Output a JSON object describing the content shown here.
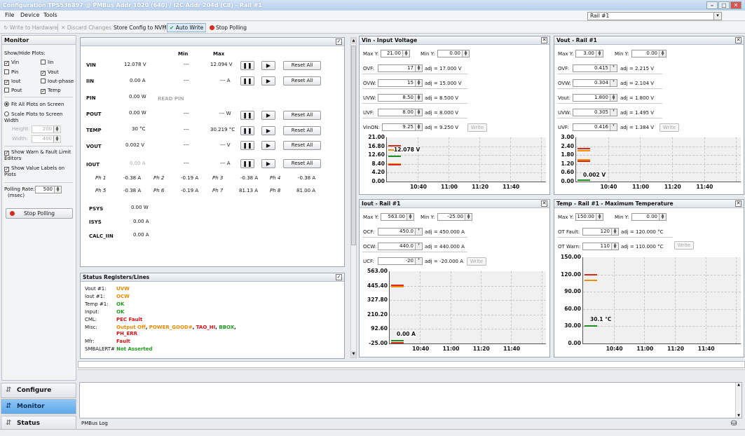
{
  "window": {
    "title": "Configuration TPS536897 @ PMBus Addr 1020 (640) / I2C Addr 204d (C8) - Rail #1"
  },
  "menu": [
    "File",
    "Device",
    "Tools"
  ],
  "rail_select": "Rail #1",
  "toolbar": {
    "write_hw": "Write to Hardware",
    "discard": "Discard Changes",
    "store": "Store Config to NVM",
    "auto_write": "Auto Write",
    "stop_polling": "Stop Polling"
  },
  "monitor": {
    "title": "Monitor",
    "show_hide": "Show/Hide Plots:",
    "plots": [
      {
        "label": "Vin",
        "checked": true
      },
      {
        "label": "Iin",
        "checked": false
      },
      {
        "label": "Pin",
        "checked": false
      },
      {
        "label": "Vout",
        "checked": true
      },
      {
        "label": "Iout",
        "checked": true
      },
      {
        "label": "Iout-phase",
        "checked": false
      },
      {
        "label": "Pout",
        "checked": false
      },
      {
        "label": "Temp",
        "checked": true
      }
    ],
    "fit_all": "Fit All Plots on Screen",
    "scale_plots": "Scale Plots to Screen Width",
    "height_label": "Height:",
    "height_value": "200",
    "width_label": "Width:",
    "width_value": "400",
    "show_warn": "Show Warn & Fault Limit Editors",
    "show_value_labels": "Show Value Labels on Plots",
    "polling_label": "Polling Rate:",
    "polling_unit": "(msec)",
    "polling_value": "500",
    "stop_polling": "Stop Polling"
  },
  "nav": {
    "configure": "Configure",
    "monitor": "Monitor",
    "status": "Status"
  },
  "readings": {
    "col_min": "Min",
    "col_max": "Max",
    "vin": {
      "label": "VIN",
      "value": "12.078 V",
      "min": "---",
      "max": "12.094 V"
    },
    "iin": {
      "label": "IIN",
      "value": "0.00 A",
      "min": "---",
      "max": "--- A"
    },
    "pin": {
      "label": "PIN",
      "value": "0.00 W",
      "note": "READ PIN"
    },
    "pout": {
      "label": "POUT",
      "value": "0.00 W",
      "min": "---",
      "max": "--- W"
    },
    "temp": {
      "label": "TEMP",
      "value": "30 °C",
      "min": "---",
      "max": "30.219 °C"
    },
    "vout": {
      "label": "VOUT",
      "value": "0.002 V",
      "min": "---",
      "max": "--- V"
    },
    "iout": {
      "label": "IOUT",
      "value": "0.00 A",
      "min": "---",
      "max": "--- A"
    },
    "reset_all": "Reset All",
    "phases": [
      {
        "name": "Ph 1",
        "value": "-0.38 A"
      },
      {
        "name": "Ph 2",
        "value": "-0.19 A"
      },
      {
        "name": "Ph 3",
        "value": "-0.38 A"
      },
      {
        "name": "Ph 4",
        "value": "-0.38 A"
      },
      {
        "name": "Ph 5",
        "value": "-0.38 A"
      },
      {
        "name": "Ph 6",
        "value": "-0.19 A"
      },
      {
        "name": "Ph 7",
        "value": "81.13 A"
      },
      {
        "name": "Ph 8",
        "value": "81.00 A"
      }
    ],
    "psys": {
      "label": "PSYS",
      "value": "0.00 W"
    },
    "isys": {
      "label": "ISYS",
      "value": "0.00 A"
    },
    "calc_iin": {
      "label": "CALC_IIN",
      "value": "0.00 A"
    }
  },
  "status_regs": {
    "title": "Status Registers/Lines",
    "rows": [
      {
        "label": "Vout #1:",
        "value": "UVW"
      },
      {
        "label": "Iout #1:",
        "value": "OCW"
      },
      {
        "label": "Temp #1:",
        "value": "OK"
      },
      {
        "label": "Input:",
        "value": "OK"
      },
      {
        "label": "CML:",
        "value": "PEC Fault"
      },
      {
        "label": "Misc:",
        "value": "Output Off, POWER_GOOD#, TAO_HI, BBOX, PH_ERR"
      },
      {
        "label": "Mfr:",
        "value": "Fault"
      },
      {
        "label": "SMBALERT#",
        "value": "Not Asserted"
      }
    ],
    "misc_parts": [
      "Output Off",
      "POWER_GOOD#",
      "TAO_HI",
      "BBOX",
      "PH_ERR"
    ],
    "colors": {
      "warn": "#e78a00",
      "ok": "#1d9a1d",
      "fault": "#d11111"
    }
  },
  "vin_panel": {
    "title": "Vin - Input Voltage",
    "maxy_label": "Max Y:",
    "maxy": "21.00",
    "miny_label": "Min Y:",
    "miny": "0.00",
    "limits": [
      {
        "label": "OVF:",
        "value": "17",
        "adj": "adj = 17.000 V"
      },
      {
        "label": "OVW:",
        "value": "15",
        "adj": "adj = 15.000 V"
      },
      {
        "label": "UVW:",
        "value": "8.50",
        "adj": "adj = 8.500 V"
      },
      {
        "label": "UVF:",
        "value": "8.00",
        "adj": "adj = 8.000 V"
      },
      {
        "label": "VinON:",
        "value": "9.25",
        "adj": "adj = 9.250 V"
      }
    ],
    "write": "Write"
  },
  "vout_panel": {
    "title": "Vout - Rail #1",
    "maxy_label": "Max Y:",
    "maxy": "3.00",
    "miny_label": "Min Y:",
    "miny": "0.00",
    "limits": [
      {
        "label": "OVF:",
        "value": "0.415",
        "adj": "adj = 2.215 V"
      },
      {
        "label": "OVW:",
        "value": "0.304",
        "adj": "adj = 2.104 V"
      },
      {
        "label": "Vout:",
        "value": "1.800",
        "adj": "adj = 1.800 V"
      },
      {
        "label": "UVW:",
        "value": "0.305",
        "adj": "adj = 1.495 V"
      },
      {
        "label": "UVF:",
        "value": "0.416",
        "adj": "adj = 1.384 V"
      }
    ],
    "write": "Write"
  },
  "iout_panel": {
    "title": "Iout - Rail #1",
    "maxy_label": "Max Y:",
    "maxy": "563.00",
    "miny_label": "Min Y:",
    "miny": "-25.00",
    "limits": [
      {
        "label": "OCF:",
        "value": "450.0",
        "adj": "adj = 450.000 A"
      },
      {
        "label": "OCW:",
        "value": "440.0",
        "adj": "adj = 440.000 A"
      },
      {
        "label": "UCF:",
        "value": "-20",
        "adj": "adj = -20.000 A"
      }
    ],
    "write": "Write"
  },
  "temp_panel": {
    "title": "Temp - Rail #1 - Maximum Temperature",
    "maxy_label": "Max Y:",
    "maxy": "150.00",
    "miny_label": "Min Y:",
    "miny": "0.00",
    "limits": [
      {
        "label": "OT Fault:",
        "value": "120",
        "adj": "adj = 120.000 °C"
      },
      {
        "label": "OT Warn:",
        "value": "110",
        "adj": "adj = 110.000 °C"
      }
    ],
    "write": "Write"
  },
  "chart_data": [
    {
      "type": "line",
      "title": "Vin - Input Voltage",
      "ylim": [
        0,
        21
      ],
      "yticks": [
        "21.00",
        "16.80",
        "12.60",
        "8.40",
        "4.20",
        "0.00"
      ],
      "xticks": [
        "10:40",
        "11:00",
        "11:20",
        "11:40"
      ],
      "value_label": "12.078 V",
      "levels": [
        {
          "name": "OVF",
          "y": 17,
          "color": "#d62a1a"
        },
        {
          "name": "OVW",
          "y": 15,
          "color": "#f08d00"
        },
        {
          "name": "VinON",
          "y": 12.1,
          "color": "#1a1a1a"
        },
        {
          "name": "UVW",
          "y": 8.5,
          "color": "#f08d00"
        },
        {
          "name": "UVF",
          "y": 8.0,
          "color": "#d62a1a"
        }
      ],
      "series": [
        {
          "y": 12.078,
          "color": "#1e8f1e"
        }
      ]
    },
    {
      "type": "line",
      "title": "Vout - Rail #1",
      "ylim": [
        0,
        3
      ],
      "yticks": [
        "3.00",
        "2.40",
        "1.80",
        "1.20",
        "0.60",
        "0.00"
      ],
      "xticks": [
        "10:40",
        "11:00",
        "11:20",
        "11:40"
      ],
      "value_label": "0.002 V",
      "levels": [
        {
          "name": "OVF",
          "y": 2.215,
          "color": "#d62a1a"
        },
        {
          "name": "OVW",
          "y": 2.104,
          "color": "#f08d00"
        },
        {
          "name": "UVW",
          "y": 1.495,
          "color": "#f08d00"
        },
        {
          "name": "UVF",
          "y": 1.384,
          "color": "#d62a1a"
        }
      ],
      "series": [
        {
          "y": 0.002,
          "color": "#1e8f1e"
        }
      ]
    },
    {
      "type": "line",
      "title": "Iout - Rail #1",
      "ylim": [
        -25,
        563
      ],
      "yticks": [
        "563.00",
        "445.40",
        "327.80",
        "210.20",
        "92.60",
        "-25.00"
      ],
      "xticks": [
        "10:40",
        "11:00",
        "11:20",
        "11:40"
      ],
      "value_label": "0.00 A",
      "levels": [
        {
          "name": "OCF",
          "y": 450,
          "color": "#d62a1a"
        },
        {
          "name": "OCW",
          "y": 440,
          "color": "#f08d00"
        },
        {
          "name": "UCF",
          "y": -20,
          "color": "#d62a1a"
        }
      ],
      "series": [
        {
          "y": 0.0,
          "color": "#1e8f1e"
        }
      ]
    },
    {
      "type": "line",
      "title": "Temp - Rail #1 - Maximum Temperature",
      "ylim": [
        0,
        150
      ],
      "yticks": [
        "150.00",
        "120.00",
        "90.00",
        "60.00",
        "30.00",
        "0.00"
      ],
      "xticks": [
        "10:40",
        "11:00",
        "11:20",
        "11:40"
      ],
      "value_label": "30.1 °C",
      "levels": [
        {
          "name": "OT Fault",
          "y": 120,
          "color": "#d62a1a"
        },
        {
          "name": "OT Warn",
          "y": 110,
          "color": "#f08d00"
        }
      ],
      "series": [
        {
          "y": 30.1,
          "color": "#1e8f1e"
        }
      ]
    }
  ],
  "log": {
    "tab": "PMBus Log"
  }
}
